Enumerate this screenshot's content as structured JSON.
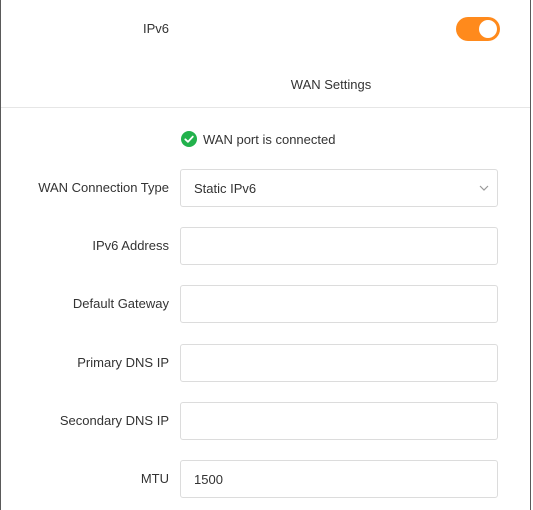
{
  "ipv6": {
    "label": "IPv6",
    "enabled": true,
    "accent_color": "#ff8a1c"
  },
  "section": {
    "title": "WAN Settings"
  },
  "status": {
    "icon": "check-circle-icon",
    "text": "WAN port is connected",
    "color": "#22b24c"
  },
  "fields": {
    "connection_type": {
      "label": "WAN Connection Type",
      "value": "Static IPv6"
    },
    "ipv6_address": {
      "label": "IPv6 Address",
      "value": ""
    },
    "default_gateway": {
      "label": "Default Gateway",
      "value": ""
    },
    "primary_dns": {
      "label": "Primary DNS IP",
      "value": ""
    },
    "secondary_dns": {
      "label": "Secondary DNS IP",
      "value": ""
    },
    "mtu": {
      "label": "MTU",
      "value": "1500"
    }
  }
}
